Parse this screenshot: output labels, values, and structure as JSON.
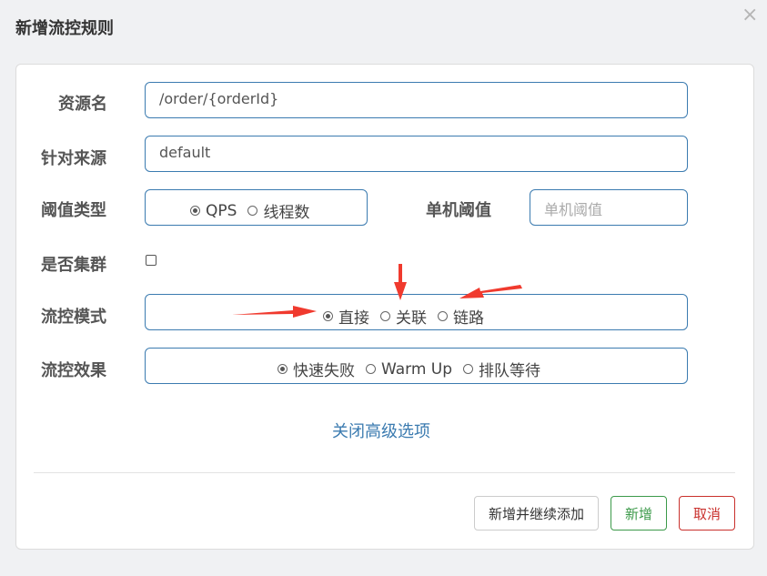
{
  "dialog": {
    "title": "新增流控规则",
    "close": "×"
  },
  "form": {
    "resource": {
      "label": "资源名",
      "value": "/order/{orderId}"
    },
    "source": {
      "label": "针对来源",
      "value": "default"
    },
    "threshold_type": {
      "label": "阈值类型",
      "options": [
        "QPS",
        "线程数"
      ],
      "selected": "QPS"
    },
    "single_threshold": {
      "label": "单机阈值",
      "placeholder": "单机阈值",
      "value": ""
    },
    "cluster": {
      "label": "是否集群",
      "checked": false
    },
    "flow_mode": {
      "label": "流控模式",
      "options": [
        "直接",
        "关联",
        "链路"
      ],
      "selected": "直接"
    },
    "flow_effect": {
      "label": "流控效果",
      "options": [
        "快速失败",
        "Warm Up",
        "排队等待"
      ],
      "selected": "快速失败"
    }
  },
  "advanced_link": "关闭高级选项",
  "buttons": {
    "add_continue": "新增并继续添加",
    "add": "新增",
    "cancel": "取消"
  },
  "colors": {
    "accent": "#3b7bb0",
    "success": "#3c9a4a",
    "danger": "#c9302c",
    "arrow": "#f03a2e"
  }
}
